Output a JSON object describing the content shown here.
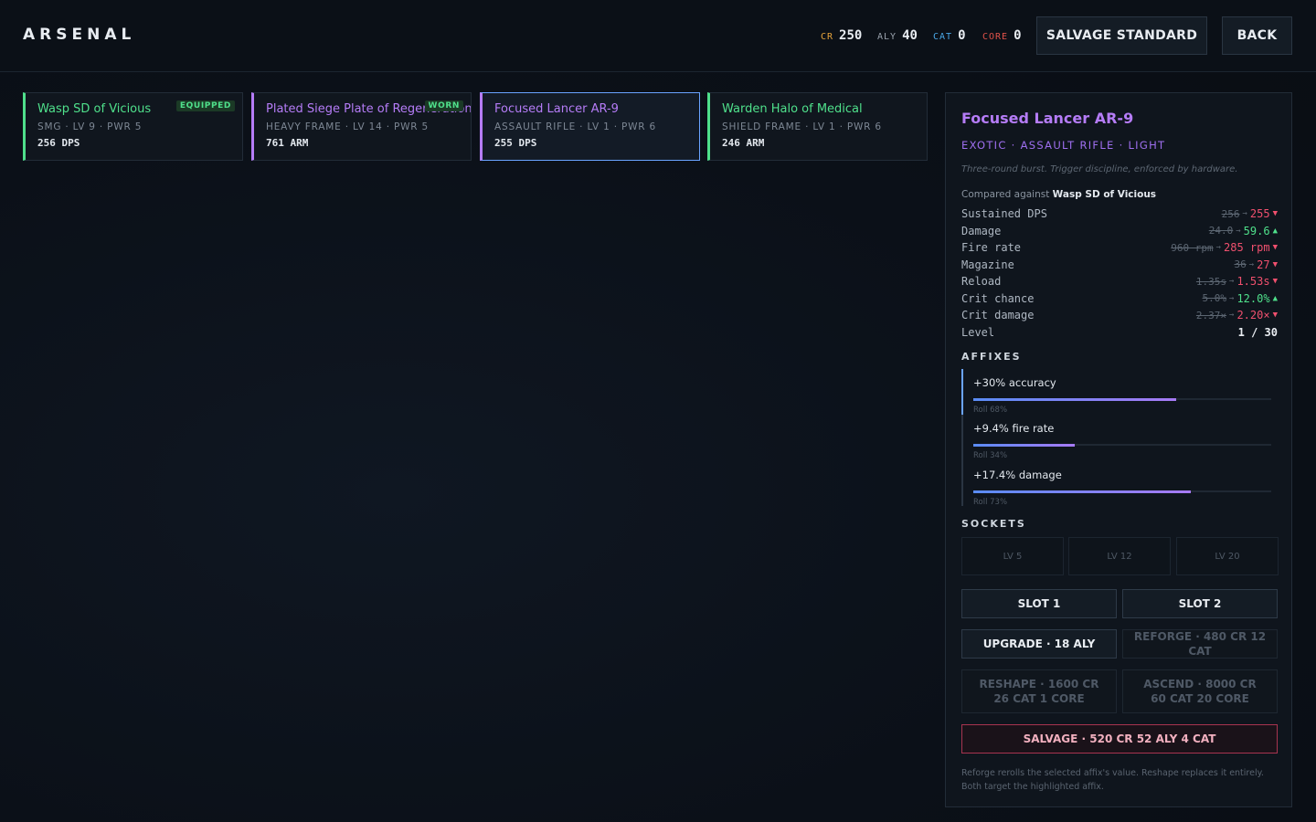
{
  "header": {
    "brand": "ARSENAL",
    "currencies": [
      {
        "label": "CR",
        "value": "250",
        "color": "#e8a53c"
      },
      {
        "label": "ALY",
        "value": "40",
        "color": "#9aa3ad"
      },
      {
        "label": "CAT",
        "value": "0",
        "color": "#4aa8e8"
      },
      {
        "label": "CORE",
        "value": "0",
        "color": "#e0524a"
      }
    ],
    "salvage_standard_label": "SALVAGE STANDARD",
    "back_label": "BACK"
  },
  "inventory": [
    {
      "name": "Wasp SD of Vicious",
      "meta": "SMG · LV 9 · PWR 5",
      "stat": "256 DPS",
      "badge": "EQUIPPED",
      "rarity_color": "#4fe08b"
    },
    {
      "name": "Plated Siege Plate of Regeneration",
      "meta": "HEAVY FRAME · LV 14 · PWR 5",
      "stat": "761 ARM",
      "badge": "WORN",
      "rarity_color": "#b57cf7"
    },
    {
      "name": "Focused Lancer AR-9",
      "meta": "ASSAULT RIFLE · LV 1 · PWR 6",
      "stat": "255 DPS",
      "badge": "",
      "rarity_color": "#b57cf7",
      "selected": true
    },
    {
      "name": "Warden Halo of Medical",
      "meta": "SHIELD FRAME · LV 1 · PWR 6",
      "stat": "246 ARM",
      "badge": "",
      "rarity_color": "#4fe08b"
    }
  ],
  "detail": {
    "title": "Focused Lancer AR-9",
    "tags": "EXOTIC · ASSAULT RIFLE · LIGHT",
    "flavor": "Three-round burst. Trigger discipline, enforced by hardware.",
    "compare_prefix": "Compared against",
    "compare_item": "Wasp SD of Vicious",
    "stats": [
      {
        "name": "Sustained DPS",
        "old": "256",
        "new": "255",
        "trend": "worse"
      },
      {
        "name": "Damage",
        "old": "24.0",
        "new": "59.6",
        "trend": "better"
      },
      {
        "name": "Fire rate",
        "old": "960 rpm",
        "new": "285 rpm",
        "trend": "worse"
      },
      {
        "name": "Magazine",
        "old": "36",
        "new": "27",
        "trend": "worse"
      },
      {
        "name": "Reload",
        "old": "1.35s",
        "new": "1.53s",
        "trend": "worse"
      },
      {
        "name": "Crit chance",
        "old": "5.0%",
        "new": "12.0%",
        "trend": "better"
      },
      {
        "name": "Crit damage",
        "old": "2.37×",
        "new": "2.20×",
        "trend": "worse"
      }
    ],
    "level": {
      "name": "Level",
      "value": "1 / 30"
    },
    "affixes_title": "AFFIXES",
    "affixes": [
      {
        "name": "+30% accuracy",
        "roll_label": "Roll 68%",
        "roll": 0.68
      },
      {
        "name": "+9.4% fire rate",
        "roll_label": "Roll 34%",
        "roll": 0.34
      },
      {
        "name": "+17.4% damage",
        "roll_label": "Roll 73%",
        "roll": 0.73
      }
    ],
    "sockets_title": "SOCKETS",
    "sockets": [
      "LV 5",
      "LV 12",
      "LV 20"
    ],
    "buttons": {
      "slot1": "SLOT 1",
      "slot2": "SLOT 2",
      "upgrade": "UPGRADE · 18 ALY",
      "reforge": "REFORGE · 480 CR 12 CAT",
      "reshape": "RESHAPE · 1600 CR 26 CAT 1 CORE",
      "ascend": "ASCEND · 8000 CR 60 CAT 20 CORE",
      "salvage": "SALVAGE · 520 CR 52 ALY 4 CAT"
    },
    "note": "Reforge rerolls the selected affix's value. Reshape replaces it entirely. Both target the highlighted affix."
  }
}
